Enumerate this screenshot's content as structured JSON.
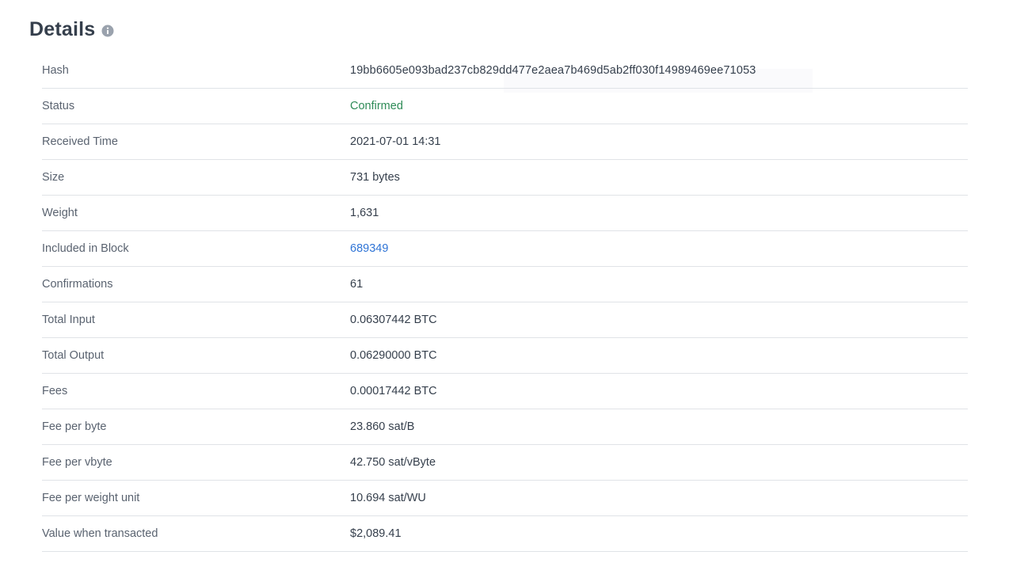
{
  "title": "Details",
  "info_icon": "info-icon",
  "rows": [
    {
      "label": "Hash",
      "value": "19bb6605e093bad237cb829dd477e2aea7b469d5ab2ff030f14989469ee71053"
    },
    {
      "label": "Status",
      "value": "Confirmed"
    },
    {
      "label": "Received Time",
      "value": "2021-07-01 14:31"
    },
    {
      "label": "Size",
      "value": "731 bytes"
    },
    {
      "label": "Weight",
      "value": "1,631"
    },
    {
      "label": "Included in Block",
      "value": "689349"
    },
    {
      "label": "Confirmations",
      "value": "61"
    },
    {
      "label": "Total Input",
      "value": "0.06307442 BTC"
    },
    {
      "label": "Total Output",
      "value": "0.06290000 BTC"
    },
    {
      "label": "Fees",
      "value": "0.00017442 BTC"
    },
    {
      "label": "Fee per byte",
      "value": "23.860 sat/B"
    },
    {
      "label": "Fee per vbyte",
      "value": "42.750 sat/vByte"
    },
    {
      "label": "Fee per weight unit",
      "value": "10.694 sat/WU"
    },
    {
      "label": "Value when transacted",
      "value": "$2,089.41"
    }
  ],
  "colors": {
    "status_confirmed": "#2e8b57",
    "link": "#2f74d6",
    "text": "#353f4c",
    "label": "#5a6370",
    "divider": "#e0e3e7"
  }
}
